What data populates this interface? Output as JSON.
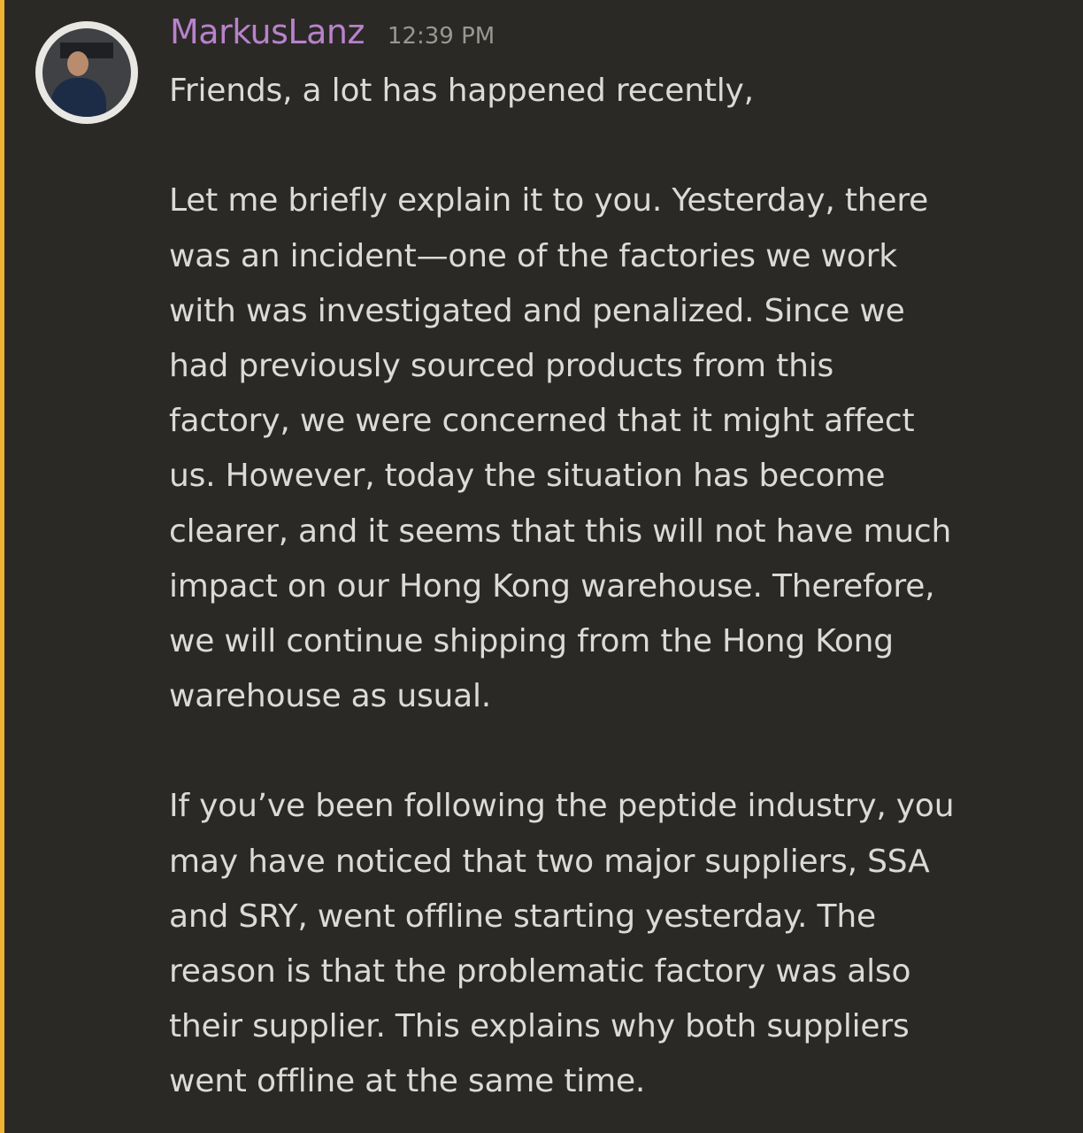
{
  "message": {
    "username": "MarkusLanz",
    "timestamp": "12:39 PM",
    "paragraphs": [
      [
        "Friends, a lot has happened recently,"
      ],
      [
        "Let me briefly explain it to you. Yesterday, there",
        "was an incident—one of the factories we work",
        "with was investigated and penalized. Since we",
        "had previously sourced products from this",
        "factory, we were concerned that it might affect",
        "us. However, today the situation has become",
        "clearer, and it seems that this will not have much",
        "impact on our Hong Kong warehouse. Therefore,",
        "we will continue shipping from the Hong Kong",
        "warehouse as usual."
      ],
      [
        "If you’ve been following the peptide industry, you",
        "may have noticed that two major suppliers, SSA",
        "and SRY, went offline starting yesterday. The",
        "reason is that the problematic factory was also",
        "their supplier. This explains why both suppliers",
        "went offline at the same time."
      ]
    ]
  },
  "colors": {
    "background": "#2b2926",
    "accent_bar": "#f0b232",
    "username": "#b882cc",
    "timestamp": "#9a9793",
    "text": "#dcdad6"
  }
}
